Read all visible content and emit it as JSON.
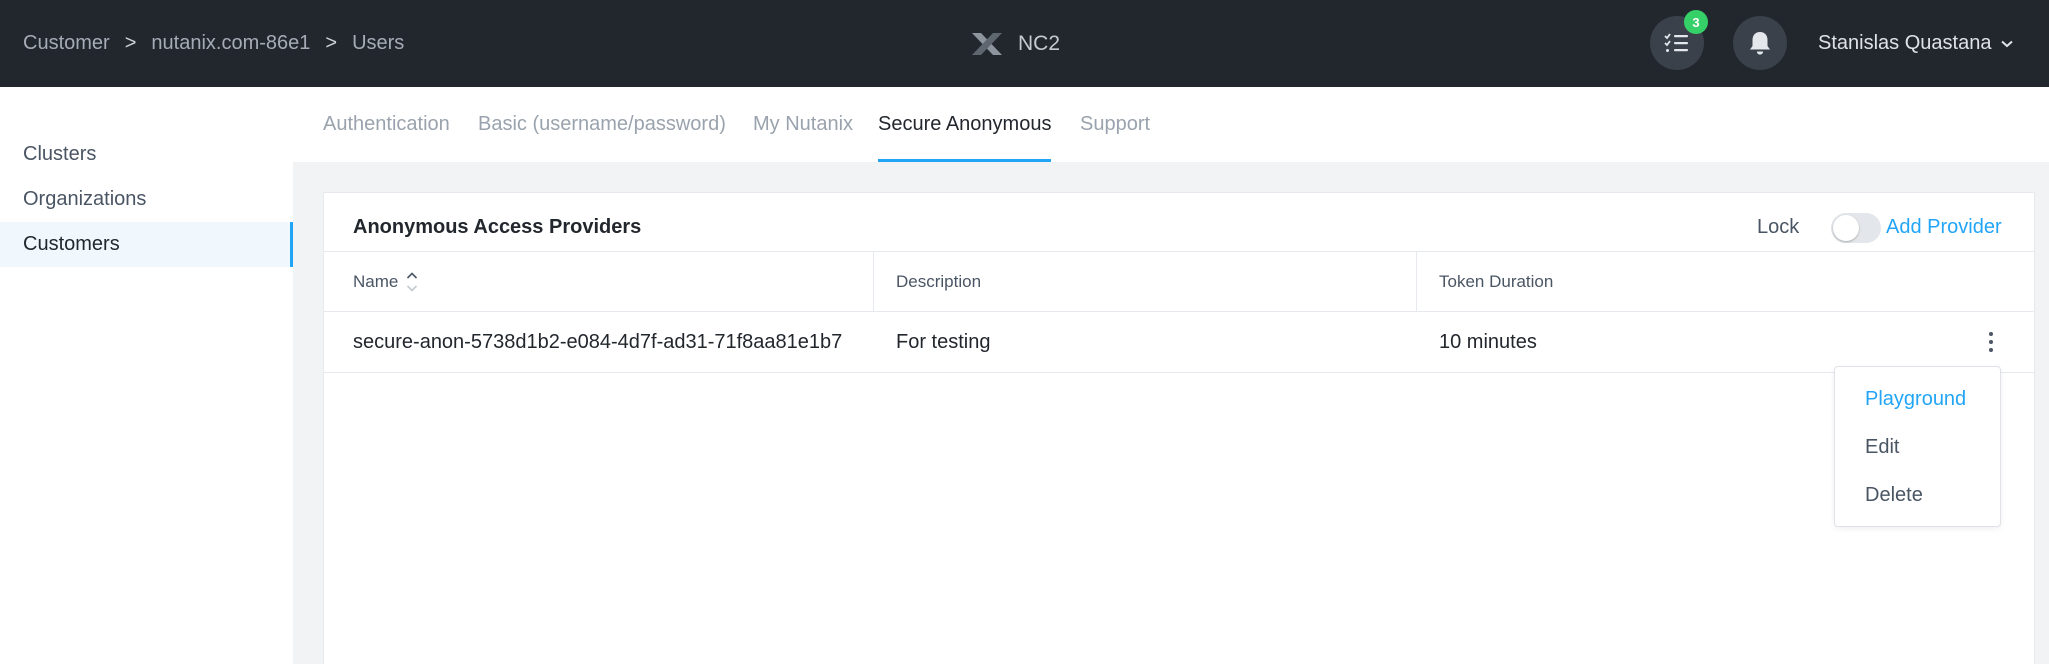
{
  "header": {
    "breadcrumb": [
      "Customer",
      "nutanix.com-86e1",
      "Users"
    ],
    "separator": ">",
    "brand_name": "NC2",
    "tasks_count": "3",
    "user_name": "Stanislas Quastana"
  },
  "sidebar": {
    "items": [
      {
        "label": "Clusters"
      },
      {
        "label": "Organizations"
      },
      {
        "label": "Customers"
      }
    ],
    "active": "Customers"
  },
  "tabs": [
    {
      "label": "Authentication"
    },
    {
      "label": "Basic (username/password)"
    },
    {
      "label": "My Nutanix"
    },
    {
      "label": "Secure Anonymous"
    },
    {
      "label": "Support"
    }
  ],
  "active_tab": "Secure Anonymous",
  "card": {
    "title": "Anonymous Access Providers",
    "lock_label": "Lock",
    "lock_enabled": false,
    "add_provider_label": "Add Provider"
  },
  "table": {
    "columns": [
      "Name",
      "Description",
      "Token Duration"
    ],
    "rows": [
      {
        "name": "secure-anon-5738d1b2-e084-4d7f-ad31-71f8aa81e1b7",
        "description": "For testing",
        "token_duration": "10 minutes"
      }
    ]
  },
  "row_menu": {
    "items": [
      "Playground",
      "Edit",
      "Delete"
    ],
    "highlighted": "Playground"
  },
  "colors": {
    "header_bg": "#22272e",
    "accent": "#22a5f7",
    "badge": "#36d068"
  }
}
